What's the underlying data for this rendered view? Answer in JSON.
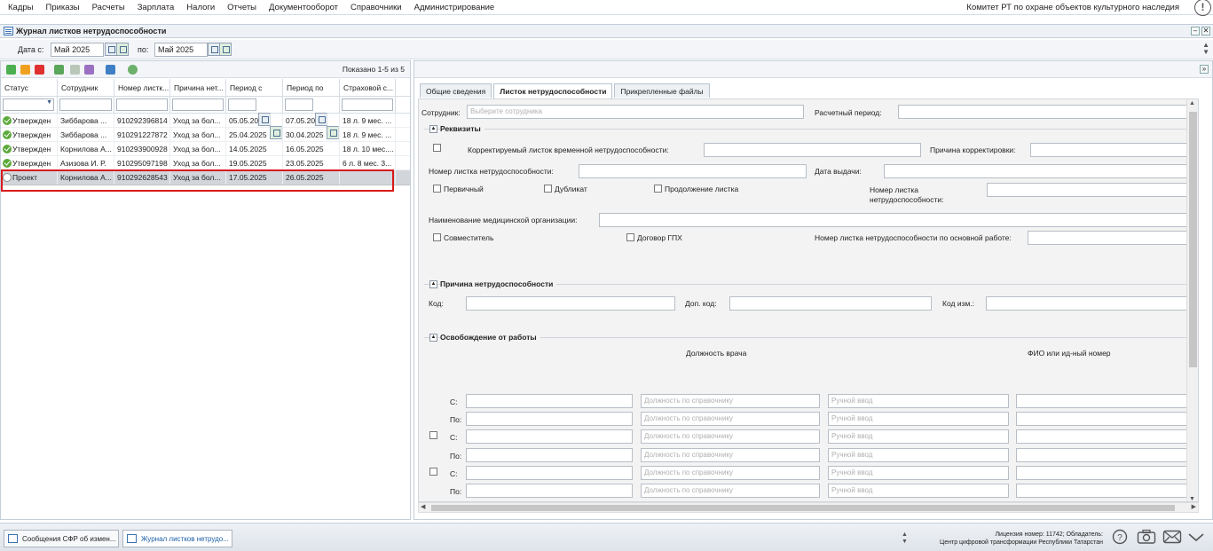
{
  "menu": [
    "Кадры",
    "Приказы",
    "Расчеты",
    "Зарплата",
    "Налоги",
    "Отчеты",
    "Документооборот",
    "Справочники",
    "Администрирование"
  ],
  "organization": "Комитет РТ по охране объектов культурного наследия",
  "alert_symbol": "!",
  "journal": {
    "title": "Журнал листков нетрудоспособности",
    "date_from_label": "Дата с:",
    "date_from": "Май 2025",
    "date_to_label": "по:",
    "date_to": "Май 2025"
  },
  "grid": {
    "shown": "Показано 1-5 из 5",
    "columns": [
      "Статус",
      "Сотрудник",
      "Номер листк...",
      "Причина нет...",
      "Период с",
      "Период по",
      "Страховой с..."
    ],
    "rows": [
      {
        "status": "Утвержден",
        "status_icon": "check-circle-icon",
        "employee": "Зиббарова ...",
        "number": "910292396814",
        "reason": "Уход за бол...",
        "from": "05.05.2025",
        "to": "07.05.2025",
        "insurance": "18 л. 9 мес. ..."
      },
      {
        "status": "Утвержден",
        "status_icon": "check-circle-icon",
        "employee": "Зиббарова ...",
        "number": "910291227872",
        "reason": "Уход за бол...",
        "from": "25.04.2025",
        "to": "30.04.2025",
        "insurance": "18 л. 9 мес. ..."
      },
      {
        "status": "Утвержден",
        "status_icon": "check-circle-icon",
        "employee": "Корнилова А...",
        "number": "910293900928",
        "reason": "Уход за бол...",
        "from": "14.05.2025",
        "to": "16.05.2025",
        "insurance": "18 л. 10 мес...."
      },
      {
        "status": "Утвержден",
        "status_icon": "check-circle-icon",
        "employee": "Азизова И. Р.",
        "number": "910295097198",
        "reason": "Уход за бол...",
        "from": "19.05.2025",
        "to": "23.05.2025",
        "insurance": "6 л. 8 мес. 3..."
      },
      {
        "status": "Проект",
        "status_icon": "draft-circle-icon",
        "employee": "Корнилова А...",
        "number": "910292628543",
        "reason": "Уход за бол...",
        "from": "17.05.2025",
        "to": "26.05.2025",
        "insurance": ""
      }
    ]
  },
  "tabs": [
    "Общие сведения",
    "Листок нетрудоспособности",
    "Прикрепленные файлы"
  ],
  "form": {
    "employee_label": "Сотрудник:",
    "employee_placeholder": "Выберите сотрудника",
    "period_label": "Расчетный период:",
    "requisites_title": "Реквизиты",
    "corrective_label": "Корректируемый листок временной нетрудоспособности:",
    "correction_reason_label": "Причина корректировки:",
    "sheet_number_label": "Номер листка нетрудоспособности:",
    "issue_date_label": "Дата выдачи:",
    "primary_label": "Первичный",
    "duplicate_label": "Дубликат",
    "continuation_label": "Продолжение листка",
    "sheet_number2_label_1": "Номер листка",
    "sheet_number2_label_2": "нетрудоспособности:",
    "med_org_label": "Наименование медицинской организации:",
    "part_time_label": "Совместитель",
    "gph_label": "Договор ГПХ",
    "main_sheet_label": "Номер листка нетрудоспособности по основной работе:",
    "cause_title": "Причина нетрудоспособности",
    "code_label": "Код:",
    "add_code_label": "Доп. код:",
    "change_code_label": "Код изм.:",
    "release_title": "Освобождение от работы",
    "doctor_pos_header": "Должность врача",
    "fio_header": "ФИО или ид-ный номер",
    "from_label": "С:",
    "to_label": "По:",
    "pos_placeholder": "Должность по справочнику",
    "manual_placeholder": "Ручной ввод"
  },
  "taskbar": {
    "tabs": [
      "Сообщения СФР об измен...",
      "Журнал листков нетрудо..."
    ],
    "license_1": "Лицензия номер: 11742; Обладатель:",
    "license_2": "Центр цифровой трансформации Республики Татарстан"
  }
}
